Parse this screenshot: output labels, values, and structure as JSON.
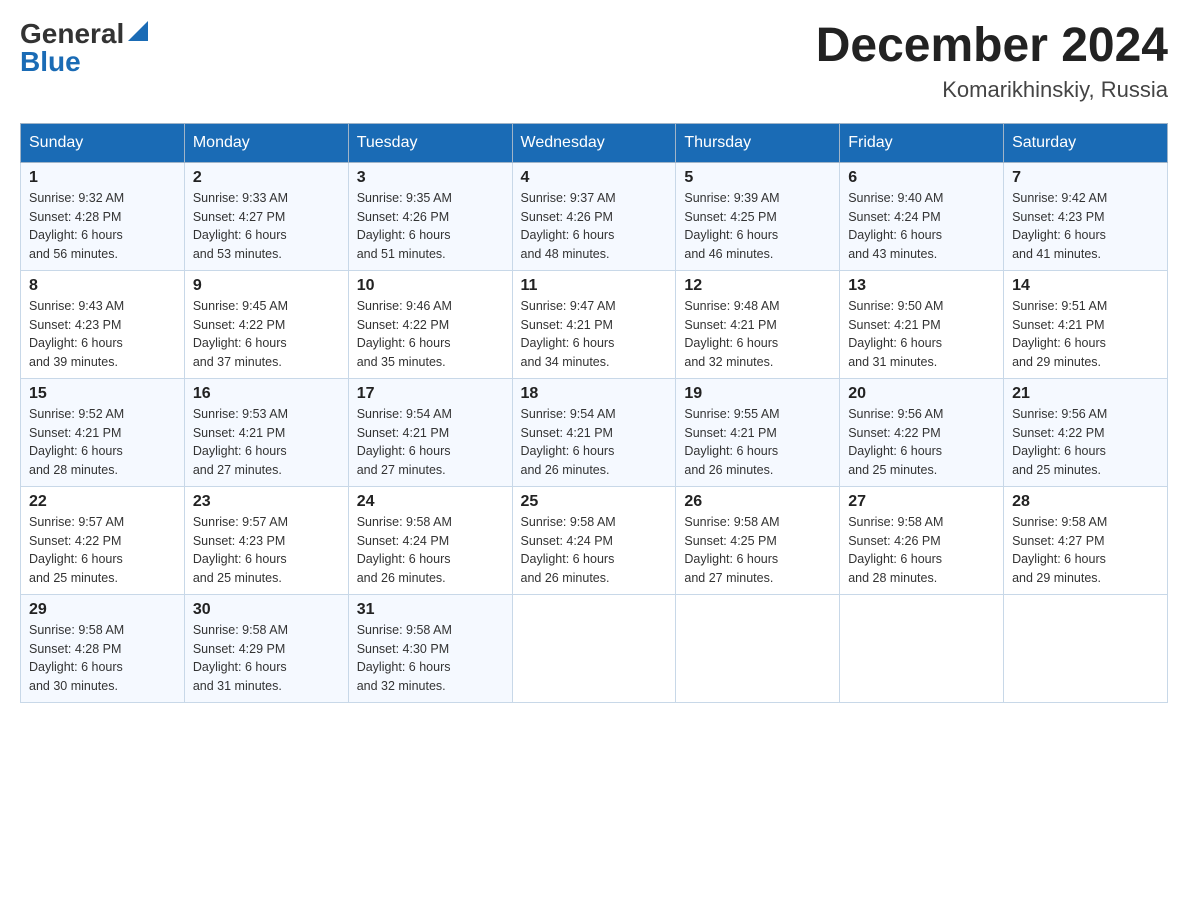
{
  "header": {
    "logo": {
      "general": "General",
      "blue": "Blue"
    },
    "title": "December 2024",
    "location": "Komarikhinskiy, Russia"
  },
  "weekdays": [
    "Sunday",
    "Monday",
    "Tuesday",
    "Wednesday",
    "Thursday",
    "Friday",
    "Saturday"
  ],
  "weeks": [
    [
      {
        "day": "1",
        "sunrise": "9:32 AM",
        "sunset": "4:28 PM",
        "daylight_hours": "6 hours",
        "daylight_minutes": "and 56 minutes."
      },
      {
        "day": "2",
        "sunrise": "9:33 AM",
        "sunset": "4:27 PM",
        "daylight_hours": "6 hours",
        "daylight_minutes": "and 53 minutes."
      },
      {
        "day": "3",
        "sunrise": "9:35 AM",
        "sunset": "4:26 PM",
        "daylight_hours": "6 hours",
        "daylight_minutes": "and 51 minutes."
      },
      {
        "day": "4",
        "sunrise": "9:37 AM",
        "sunset": "4:26 PM",
        "daylight_hours": "6 hours",
        "daylight_minutes": "and 48 minutes."
      },
      {
        "day": "5",
        "sunrise": "9:39 AM",
        "sunset": "4:25 PM",
        "daylight_hours": "6 hours",
        "daylight_minutes": "and 46 minutes."
      },
      {
        "day": "6",
        "sunrise": "9:40 AM",
        "sunset": "4:24 PM",
        "daylight_hours": "6 hours",
        "daylight_minutes": "and 43 minutes."
      },
      {
        "day": "7",
        "sunrise": "9:42 AM",
        "sunset": "4:23 PM",
        "daylight_hours": "6 hours",
        "daylight_minutes": "and 41 minutes."
      }
    ],
    [
      {
        "day": "8",
        "sunrise": "9:43 AM",
        "sunset": "4:23 PM",
        "daylight_hours": "6 hours",
        "daylight_minutes": "and 39 minutes."
      },
      {
        "day": "9",
        "sunrise": "9:45 AM",
        "sunset": "4:22 PM",
        "daylight_hours": "6 hours",
        "daylight_minutes": "and 37 minutes."
      },
      {
        "day": "10",
        "sunrise": "9:46 AM",
        "sunset": "4:22 PM",
        "daylight_hours": "6 hours",
        "daylight_minutes": "and 35 minutes."
      },
      {
        "day": "11",
        "sunrise": "9:47 AM",
        "sunset": "4:21 PM",
        "daylight_hours": "6 hours",
        "daylight_minutes": "and 34 minutes."
      },
      {
        "day": "12",
        "sunrise": "9:48 AM",
        "sunset": "4:21 PM",
        "daylight_hours": "6 hours",
        "daylight_minutes": "and 32 minutes."
      },
      {
        "day": "13",
        "sunrise": "9:50 AM",
        "sunset": "4:21 PM",
        "daylight_hours": "6 hours",
        "daylight_minutes": "and 31 minutes."
      },
      {
        "day": "14",
        "sunrise": "9:51 AM",
        "sunset": "4:21 PM",
        "daylight_hours": "6 hours",
        "daylight_minutes": "and 29 minutes."
      }
    ],
    [
      {
        "day": "15",
        "sunrise": "9:52 AM",
        "sunset": "4:21 PM",
        "daylight_hours": "6 hours",
        "daylight_minutes": "and 28 minutes."
      },
      {
        "day": "16",
        "sunrise": "9:53 AM",
        "sunset": "4:21 PM",
        "daylight_hours": "6 hours",
        "daylight_minutes": "and 27 minutes."
      },
      {
        "day": "17",
        "sunrise": "9:54 AM",
        "sunset": "4:21 PM",
        "daylight_hours": "6 hours",
        "daylight_minutes": "and 27 minutes."
      },
      {
        "day": "18",
        "sunrise": "9:54 AM",
        "sunset": "4:21 PM",
        "daylight_hours": "6 hours",
        "daylight_minutes": "and 26 minutes."
      },
      {
        "day": "19",
        "sunrise": "9:55 AM",
        "sunset": "4:21 PM",
        "daylight_hours": "6 hours",
        "daylight_minutes": "and 26 minutes."
      },
      {
        "day": "20",
        "sunrise": "9:56 AM",
        "sunset": "4:22 PM",
        "daylight_hours": "6 hours",
        "daylight_minutes": "and 25 minutes."
      },
      {
        "day": "21",
        "sunrise": "9:56 AM",
        "sunset": "4:22 PM",
        "daylight_hours": "6 hours",
        "daylight_minutes": "and 25 minutes."
      }
    ],
    [
      {
        "day": "22",
        "sunrise": "9:57 AM",
        "sunset": "4:22 PM",
        "daylight_hours": "6 hours",
        "daylight_minutes": "and 25 minutes."
      },
      {
        "day": "23",
        "sunrise": "9:57 AM",
        "sunset": "4:23 PM",
        "daylight_hours": "6 hours",
        "daylight_minutes": "and 25 minutes."
      },
      {
        "day": "24",
        "sunrise": "9:58 AM",
        "sunset": "4:24 PM",
        "daylight_hours": "6 hours",
        "daylight_minutes": "and 26 minutes."
      },
      {
        "day": "25",
        "sunrise": "9:58 AM",
        "sunset": "4:24 PM",
        "daylight_hours": "6 hours",
        "daylight_minutes": "and 26 minutes."
      },
      {
        "day": "26",
        "sunrise": "9:58 AM",
        "sunset": "4:25 PM",
        "daylight_hours": "6 hours",
        "daylight_minutes": "and 27 minutes."
      },
      {
        "day": "27",
        "sunrise": "9:58 AM",
        "sunset": "4:26 PM",
        "daylight_hours": "6 hours",
        "daylight_minutes": "and 28 minutes."
      },
      {
        "day": "28",
        "sunrise": "9:58 AM",
        "sunset": "4:27 PM",
        "daylight_hours": "6 hours",
        "daylight_minutes": "and 29 minutes."
      }
    ],
    [
      {
        "day": "29",
        "sunrise": "9:58 AM",
        "sunset": "4:28 PM",
        "daylight_hours": "6 hours",
        "daylight_minutes": "and 30 minutes."
      },
      {
        "day": "30",
        "sunrise": "9:58 AM",
        "sunset": "4:29 PM",
        "daylight_hours": "6 hours",
        "daylight_minutes": "and 31 minutes."
      },
      {
        "day": "31",
        "sunrise": "9:58 AM",
        "sunset": "4:30 PM",
        "daylight_hours": "6 hours",
        "daylight_minutes": "and 32 minutes."
      },
      null,
      null,
      null,
      null
    ]
  ],
  "labels": {
    "sunrise": "Sunrise:",
    "sunset": "Sunset:",
    "daylight": "Daylight:"
  }
}
